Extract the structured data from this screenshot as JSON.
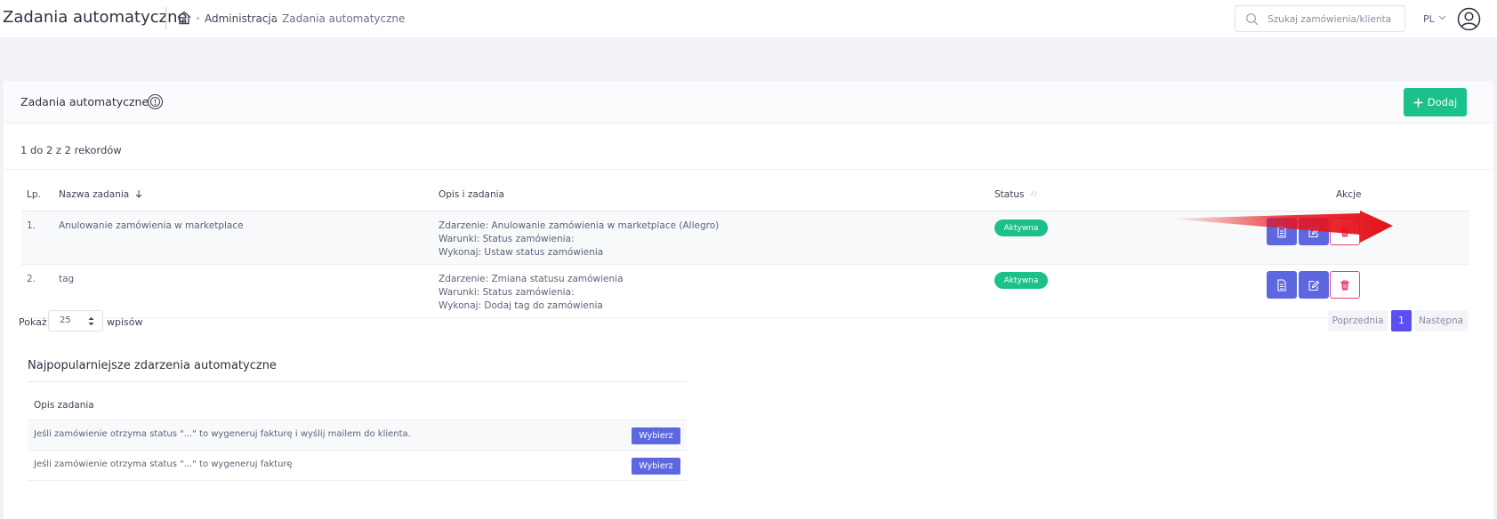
{
  "header": {
    "app_title": "Zadania automatyczne",
    "breadcrumb": [
      "Administracja",
      "Zadania automatyczne"
    ],
    "search_placeholder": "Szukaj zamówienia/klienta",
    "language": "PL"
  },
  "card": {
    "title": "Zadania automatyczne",
    "add_label": "Dodaj",
    "records_info": "1 do 2 z 2 rekordów"
  },
  "table": {
    "columns": [
      "Lp.",
      "Nazwa zadania",
      "Opis i zadania",
      "Status",
      "Akcje"
    ],
    "rows": [
      {
        "lp": "1.",
        "name": "Anulowanie zamówienia w marketplace",
        "event": "Zdarzenie: Anulowanie zamówienia w marketplace (Allegro)",
        "conditions": "Warunki:  Status zamówienia:",
        "action": "Wykonaj:  Ustaw status zamówienia",
        "status": "Aktywna"
      },
      {
        "lp": "2.",
        "name": "tag",
        "event": "Zdarzenie: Zmiana statusu zamówienia",
        "conditions": "Warunki:  Status zamówienia:",
        "action": "Wykonaj:  Dodaj tag do zamówienia",
        "status": "Aktywna"
      }
    ]
  },
  "pagination": {
    "show_label": "Pokaż",
    "page_size": "25",
    "entries_label": "wpisów",
    "prev": "Poprzednia",
    "current": "1",
    "next": "Następna"
  },
  "popular": {
    "title": "Najpopularniejsze zdarzenia automatyczne",
    "column": "Opis zadania",
    "rows": [
      "Jeśli zamówienie otrzyma status \"...\" to wygeneruj fakturę i wyślij mailem do klienta.",
      "Jeśli zamówienie otrzyma status \"...\" to wygeneruj fakturę"
    ],
    "choose_label": "Wybierz"
  },
  "colors": {
    "green": "#1bc08a",
    "blue": "#5c67e0",
    "danger": "#e8407a",
    "pagination_active": "#5b4ef3",
    "annotation_arrow": "#e8141b"
  },
  "icons": [
    "home-icon",
    "search-icon",
    "chevron-down-icon",
    "user-circle-icon",
    "help-circle-icon",
    "plus-icon",
    "sort-arrow-icon",
    "document-icon",
    "edit-icon",
    "trash-icon",
    "annotation-arrow"
  ]
}
